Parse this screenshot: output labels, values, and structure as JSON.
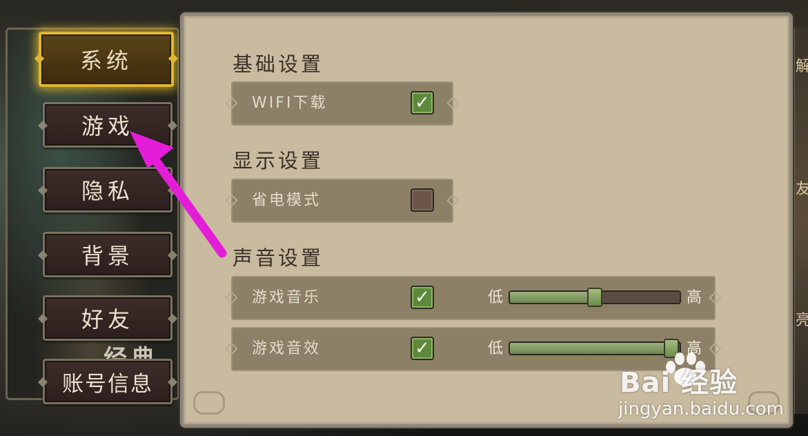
{
  "sidebar": {
    "tabs": [
      {
        "label": "系统",
        "active": true
      },
      {
        "label": "游戏",
        "active": false
      },
      {
        "label": "隐私",
        "active": false
      },
      {
        "label": "背景",
        "active": false
      },
      {
        "label": "好友",
        "active": false
      },
      {
        "label": "账号信息",
        "active": false
      }
    ],
    "bg_text": "经典"
  },
  "right_edge_glyphs": [
    "解",
    "友",
    "亮"
  ],
  "settings": {
    "basic": {
      "title": "基础设置",
      "wifi": {
        "label": "WIFI下载",
        "checked": true
      }
    },
    "display": {
      "title": "显示设置",
      "power_saving": {
        "label": "省电模式",
        "checked": false
      }
    },
    "sound": {
      "title": "声音设置",
      "music": {
        "label": "游戏音乐",
        "checked": true,
        "low": "低",
        "high": "高",
        "level": 0.5
      },
      "effects": {
        "label": "游戏音效",
        "checked": true,
        "low": "低",
        "high": "高",
        "level": 0.95
      }
    }
  },
  "watermark": {
    "logo_text": "Bai  经验",
    "url": "jingyan.baidu.com"
  },
  "colors": {
    "active_tab_glow": "#e0b532",
    "arrow": "#e41ed8",
    "checkbox_on": "#5d8a3a",
    "panel_bg": "#c9bb9f"
  },
  "icons": {
    "check": "check-icon",
    "arrow": "pointer-arrow"
  }
}
